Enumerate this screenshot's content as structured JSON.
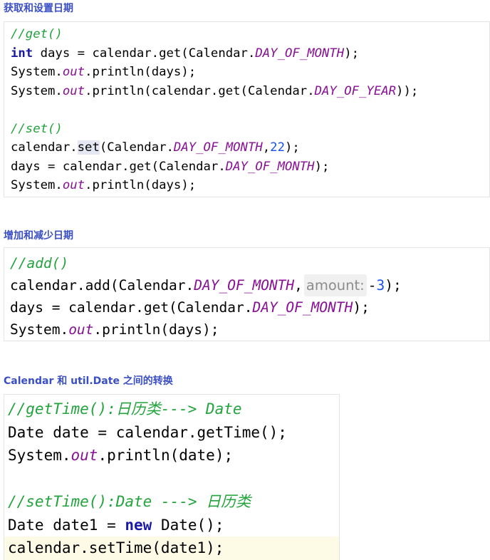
{
  "sections": [
    {
      "heading": "获取和设置日期",
      "lines": [
        [
          {
            "t": "//get()",
            "c": "cm"
          }
        ],
        [
          {
            "t": "int",
            "c": "kw"
          },
          {
            "t": " days = calendar.get(Calendar."
          },
          {
            "t": "DAY_OF_MONTH",
            "c": "cst"
          },
          {
            "t": ");"
          }
        ],
        [
          {
            "t": "System."
          },
          {
            "t": "out",
            "c": "fld"
          },
          {
            "t": ".println(days);"
          }
        ],
        [
          {
            "t": "System."
          },
          {
            "t": "out",
            "c": "fld"
          },
          {
            "t": ".println(calendar.get(Calendar."
          },
          {
            "t": "DAY_OF_YEAR",
            "c": "cst"
          },
          {
            "t": "));"
          }
        ],
        [],
        [
          {
            "t": "//set()",
            "c": "cm"
          }
        ],
        [
          {
            "t": "calendar."
          },
          {
            "t": "set",
            "c": "hl"
          },
          {
            "t": "(Calendar."
          },
          {
            "t": "DAY_OF_MONTH",
            "c": "cst"
          },
          {
            "t": ","
          },
          {
            "t": "22",
            "c": "num"
          },
          {
            "t": ");"
          }
        ],
        [
          {
            "t": "days = calendar.get(Calendar."
          },
          {
            "t": "DAY_OF_MONTH",
            "c": "cst"
          },
          {
            "t": ");"
          }
        ],
        [
          {
            "t": "System."
          },
          {
            "t": "out",
            "c": "fld"
          },
          {
            "t": ".println(days);"
          }
        ]
      ]
    },
    {
      "heading": "增加和减少日期",
      "lines": [
        [
          {
            "t": "//add()",
            "c": "cm"
          }
        ],
        [
          {
            "t": "calendar.add(Calendar."
          },
          {
            "t": "DAY_OF_MONTH",
            "c": "cst"
          },
          {
            "t": ","
          },
          {
            "t": "amount:",
            "c": "hint"
          },
          {
            "t": "-"
          },
          {
            "t": "3",
            "c": "num"
          },
          {
            "t": ");"
          }
        ],
        [
          {
            "t": "days = calendar.get(Calendar."
          },
          {
            "t": "DAY_OF_MONTH",
            "c": "cst"
          },
          {
            "t": ");"
          }
        ],
        [
          {
            "t": "System."
          },
          {
            "t": "out",
            "c": "fld"
          },
          {
            "t": ".println(days);"
          }
        ]
      ]
    },
    {
      "heading": "Calendar 和 util.Date 之间的转换",
      "lines": [
        [
          {
            "t": "//getTime():日历类---> Date",
            "c": "cm"
          }
        ],
        [
          {
            "t": "Date date = calendar.getTime();"
          }
        ],
        [
          {
            "t": "System."
          },
          {
            "t": "out",
            "c": "fld"
          },
          {
            "t": ".println(date);"
          }
        ],
        [],
        [
          {
            "t": "//setTime():Date ---> 日历类",
            "c": "cm"
          }
        ],
        [
          {
            "t": "Date date1 = "
          },
          {
            "t": "new",
            "c": "kw"
          },
          {
            "t": " Date();"
          }
        ],
        [
          {
            "t": "calendar.setTime(date1);"
          }
        ]
      ]
    }
  ],
  "colors": {
    "heading": "#3a4fc4",
    "comment": "#22a33c",
    "keyword": "#1a1aa6",
    "static_field": "#871094",
    "number": "#1750eb",
    "hint_background": "#f0f0f0",
    "current_line": "#fdfbe6"
  }
}
